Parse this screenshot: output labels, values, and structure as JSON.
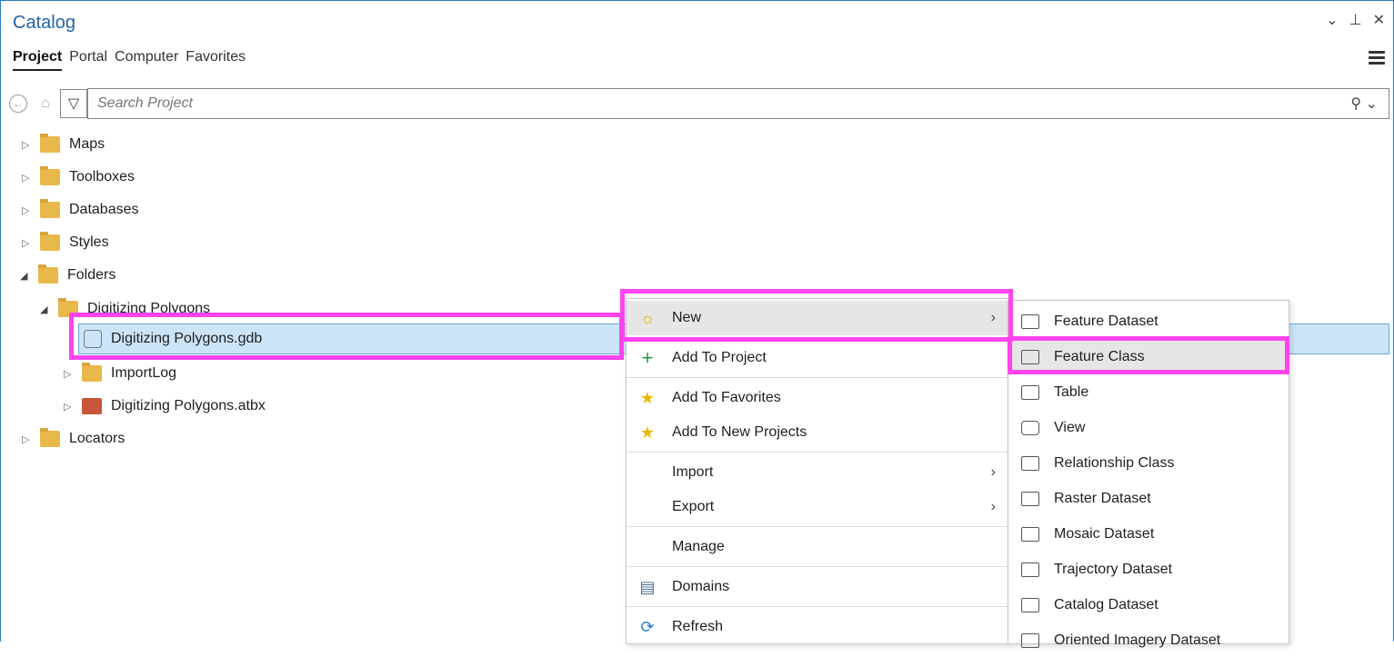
{
  "header": {
    "title": "Catalog"
  },
  "window_controls": {
    "dropdown": "⌄",
    "pin": "⊥",
    "close": "✕"
  },
  "tabs": [
    {
      "label": "Project",
      "active": true
    },
    {
      "label": "Portal"
    },
    {
      "label": "Computer"
    },
    {
      "label": "Favorites"
    }
  ],
  "search": {
    "placeholder": "Search Project"
  },
  "tree": {
    "maps": "Maps",
    "toolboxes": "Toolboxes",
    "databases": "Databases",
    "styles": "Styles",
    "folders": "Folders",
    "digitizing_polygons": "Digitizing Polygons",
    "gdb": "Digitizing Polygons.gdb",
    "importlog": "ImportLog",
    "atbx": "Digitizing Polygons.atbx",
    "locators": "Locators"
  },
  "context_menu": {
    "new": "New",
    "add_to_project": "Add To Project",
    "add_to_favorites": "Add To Favorites",
    "add_to_new_projects": "Add To New Projects",
    "import": "Import",
    "export": "Export",
    "manage": "Manage",
    "domains": "Domains",
    "refresh": "Refresh"
  },
  "submenu": {
    "feature_dataset": "Feature Dataset",
    "feature_class": "Feature Class",
    "table": "Table",
    "view": "View",
    "relationship_class": "Relationship Class",
    "raster_dataset": "Raster Dataset",
    "mosaic_dataset": "Mosaic Dataset",
    "trajectory_dataset": "Trajectory Dataset",
    "catalog_dataset": "Catalog Dataset",
    "oriented_imagery_dataset": "Oriented Imagery Dataset"
  },
  "colors": {
    "accent": "#2462a8",
    "highlight": "#ff44ee",
    "selection": "#cce4f7"
  }
}
